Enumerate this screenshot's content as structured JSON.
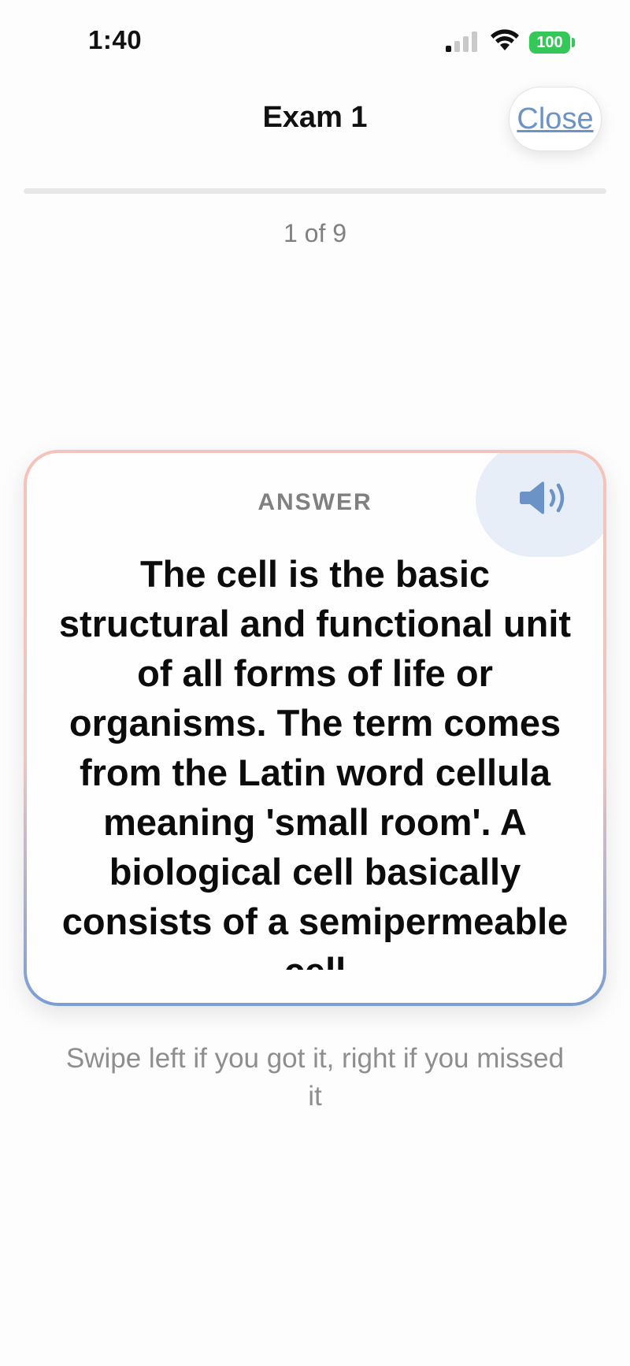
{
  "status_bar": {
    "time": "1:40",
    "battery": "100",
    "signal_bars_active": 1,
    "signal_bars_total": 4
  },
  "header": {
    "title": "Exam 1",
    "close_label": "Close"
  },
  "progress": {
    "current": 1,
    "total": 9,
    "label": "1 of 9"
  },
  "card": {
    "label": "ANSWER",
    "text": "The cell is the basic structural and functional unit of all forms of life or organisms. The term comes from the Latin word cellula meaning 'small room'. A biological cell basically consists of a semipermeable cell",
    "speaker_icon": "speaker-icon"
  },
  "hint": "Swipe left if you got it, right if you missed it",
  "colors": {
    "accent": "#6c93c6",
    "battery": "#36c759",
    "card_border_top": "#f4c3bc",
    "card_border_bottom": "#7b9ed2"
  }
}
